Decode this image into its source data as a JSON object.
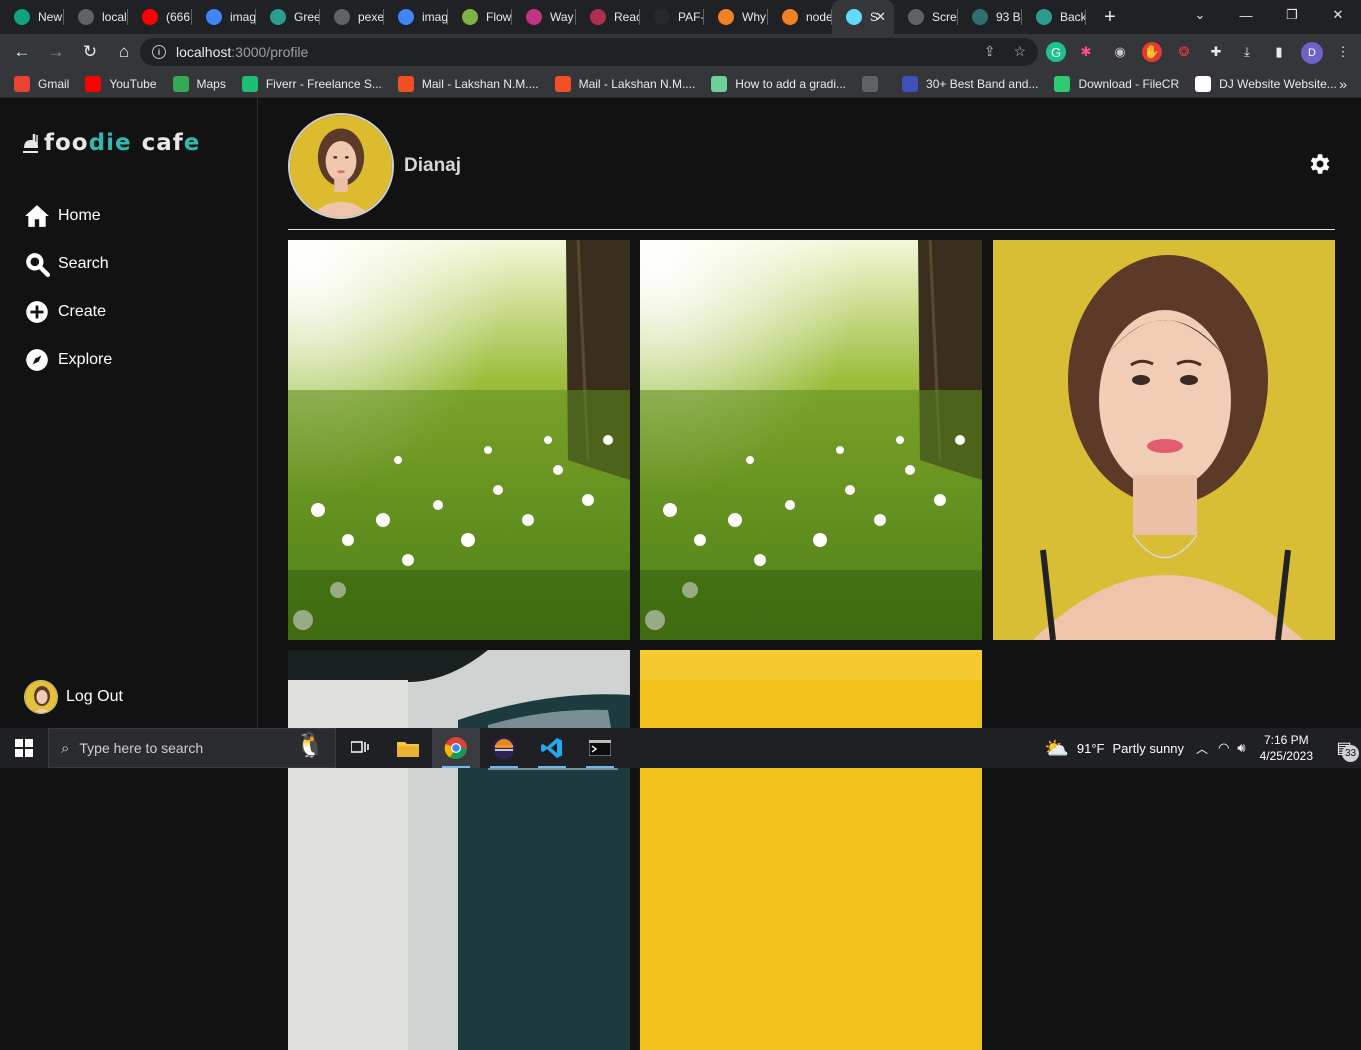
{
  "browser": {
    "tabs": [
      {
        "label": "New",
        "icon": "chatgpt-icon",
        "color": "#10a37f"
      },
      {
        "label": "local",
        "icon": "globe-icon",
        "color": "#5f6368"
      },
      {
        "label": "(666",
        "icon": "youtube-icon",
        "color": "#ff0000"
      },
      {
        "label": "imag",
        "icon": "google-icon",
        "color": "#4285f4"
      },
      {
        "label": "Gree",
        "icon": "dora-icon",
        "color": "#2a9d8f"
      },
      {
        "label": "pexe",
        "icon": "globe-icon",
        "color": "#5f6368"
      },
      {
        "label": "imag",
        "icon": "google-icon",
        "color": "#4285f4"
      },
      {
        "label": "Flow",
        "icon": "px-icon",
        "color": "#7cb342"
      },
      {
        "label": "Way",
        "icon": "instagram-icon",
        "color": "#c13584"
      },
      {
        "label": "Reac",
        "icon": "react-icon",
        "color": "#b03050"
      },
      {
        "label": "PAF-",
        "icon": "github-icon",
        "color": "#24292e"
      },
      {
        "label": "Why",
        "icon": "stackoverflow-icon",
        "color": "#f48024"
      },
      {
        "label": "node",
        "icon": "stackoverflow-icon",
        "color": "#f48024"
      },
      {
        "label": "S",
        "icon": "react-icon",
        "color": "#61dafb",
        "active": true
      },
      {
        "label": "Scre",
        "icon": "camera-icon",
        "color": "#5f6368"
      },
      {
        "label": "93 B",
        "icon": "tab-icon",
        "color": "#2f6f6f"
      },
      {
        "label": "Back",
        "icon": "dora-icon",
        "color": "#2a9d8f"
      }
    ],
    "url_host": "localhost",
    "url_path": ":3000/profile",
    "profile_initial": "D",
    "bookmarks": [
      {
        "label": "Gmail",
        "icon": "gmail-icon",
        "color": "#ea4335"
      },
      {
        "label": "YouTube",
        "icon": "youtube-icon",
        "color": "#ff0000"
      },
      {
        "label": "Maps",
        "icon": "maps-icon",
        "color": "#34a853"
      },
      {
        "label": "Fiverr - Freelance S...",
        "icon": "fiverr-icon",
        "color": "#1dbf73"
      },
      {
        "label": "Mail - Lakshan N.M....",
        "icon": "microsoft-icon",
        "color": "#f25022"
      },
      {
        "label": "Mail - Lakshan N.M....",
        "icon": "microsoft-icon",
        "color": "#f25022"
      },
      {
        "label": "How to add a gradi...",
        "icon": "gradient-icon",
        "color": "#6fcf97"
      },
      {
        "label": "",
        "icon": "globe-icon",
        "color": "#5f6368"
      },
      {
        "label": "30+ Best Band and...",
        "icon": "w-icon",
        "color": "#3f51b5"
      },
      {
        "label": "Download - FileCR",
        "icon": "filecr-icon",
        "color": "#2ecc71"
      },
      {
        "label": "DJ Website Website...",
        "icon": "s-icon",
        "color": "#ffffff"
      }
    ]
  },
  "app": {
    "logo_a": "foo",
    "logo_b": "die",
    "logo_c": "caf",
    "logo_d": "e",
    "nav": [
      {
        "label": "Home",
        "icon": "home-icon"
      },
      {
        "label": "Search",
        "icon": "search-icon"
      },
      {
        "label": "Create",
        "icon": "plus-circle-icon"
      },
      {
        "label": "Explore",
        "icon": "compass-icon"
      }
    ],
    "logout_label": "Log Out",
    "username": "Dianaj"
  },
  "taskbar": {
    "search_placeholder": "Type here to search",
    "temperature": "91°F",
    "weather": "Partly sunny",
    "time": "7:16 PM",
    "date": "4/25/2023",
    "notification_count": "33"
  }
}
